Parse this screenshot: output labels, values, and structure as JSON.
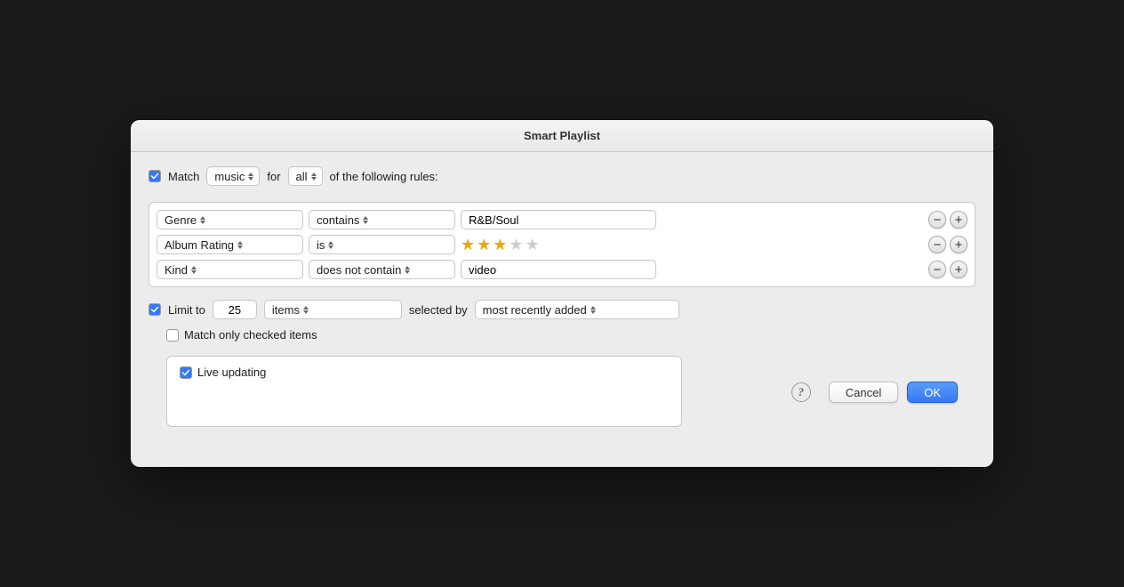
{
  "dialog": {
    "title": "Smart Playlist"
  },
  "match_row": {
    "checkbox_checked": true,
    "label_match": "Match",
    "select_music_value": "music",
    "label_for": "for",
    "select_all_value": "all",
    "label_rules": "of the following rules:"
  },
  "rules": [
    {
      "field": "Genre",
      "condition": "contains",
      "value_type": "text",
      "value": "R&B/Soul"
    },
    {
      "field": "Album Rating",
      "condition": "is",
      "value_type": "stars",
      "stars_filled": 3,
      "stars_total": 5
    },
    {
      "field": "Kind",
      "condition": "does not contain",
      "value_type": "text",
      "value": "video"
    }
  ],
  "limit_row": {
    "checkbox_checked": true,
    "label_limit": "Limit to",
    "number_value": "25",
    "select_items_value": "items",
    "label_selected_by": "selected by",
    "select_recently_value": "most recently added"
  },
  "options": {
    "match_checked_label": "Match only checked items",
    "match_checked": false,
    "live_updating_label": "Live updating",
    "live_updating_checked": true
  },
  "buttons": {
    "help_label": "?",
    "cancel_label": "Cancel",
    "ok_label": "OK"
  },
  "icons": {
    "checkmark": "✓",
    "minus": "−",
    "plus": "+"
  }
}
